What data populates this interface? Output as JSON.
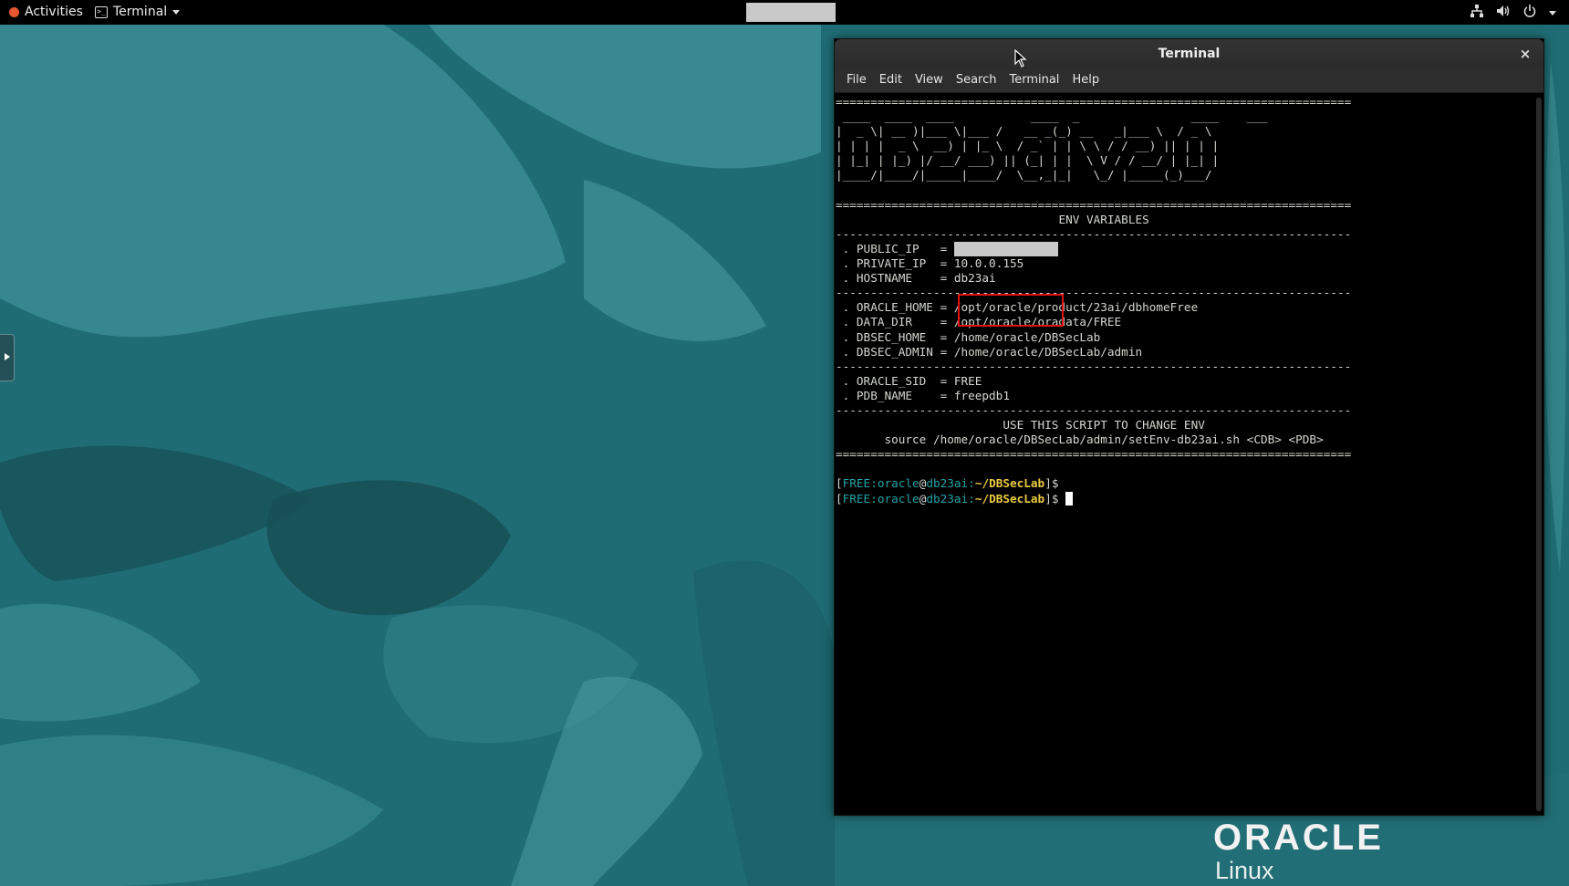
{
  "topbar": {
    "activities_label": "Activities",
    "app_menu_label": "Terminal"
  },
  "terminal": {
    "title": "Terminal",
    "close_label": "×",
    "menu": [
      "File",
      "Edit",
      "View",
      "Search",
      "Terminal",
      "Help"
    ],
    "banner_rule": "==========================================================================",
    "dash_rule": "--------------------------------------------------------------------------",
    "ascii_art": [
      " ____  ____  ____           ____  _                ____    ___",
      "|  _ \\| __ )|___ \\|___ /   __ _(_) __   _|___ \\  / _ \\",
      "| | | |  _ \\  __) | |_ \\  / _` | | \\ \\ / / __) || | | |",
      "| |_| | |_) |/ __/ ___) || (_| | |  \\ V / / __/ | |_| |",
      "|____/|____/|_____|____/  \\__,_|_|   \\_/ |_____(_)___/"
    ],
    "env_header": "ENV VARIABLES",
    "public_ip_label": " . PUBLIC_IP   = ",
    "private_ip_label": " . PRIVATE_IP  = ",
    "private_ip": "10.0.0.155",
    "hostname_label": " . HOSTNAME    = ",
    "hostname": "db23ai",
    "oracle_home": " . ORACLE_HOME = /opt/oracle/product/23ai/dbhomeFree",
    "data_dir": " . DATA_DIR    = /opt/oracle/oradata/FREE",
    "dbsec_home": " . DBSEC_HOME  = /home/oracle/DBSecLab",
    "dbsec_admin": " . DBSEC_ADMIN = /home/oracle/DBSecLab/admin",
    "oracle_sid": " . ORACLE_SID  = FREE",
    "pdb_name": " . PDB_NAME    = freepdb1",
    "script_header": "USE THIS SCRIPT TO CHANGE ENV",
    "script_cmd": "source /home/oracle/DBSecLab/admin/setEnv-db23ai.sh <CDB> <PDB>",
    "prompt": {
      "open": "[",
      "sid": "FREE",
      "sep": ":",
      "user": "oracle",
      "at": "@",
      "host": "db23ai",
      "colon": ":",
      "path": "~/DBSecLab",
      "close": "]$"
    }
  },
  "logo": {
    "oracle": "ORACLE",
    "linux": "Linux"
  },
  "colors": {
    "wallpaper": "#1d6b73",
    "highlight_box": "#e01010",
    "prompt_teal": "#22a3a8",
    "prompt_path": "#e8c93f"
  }
}
